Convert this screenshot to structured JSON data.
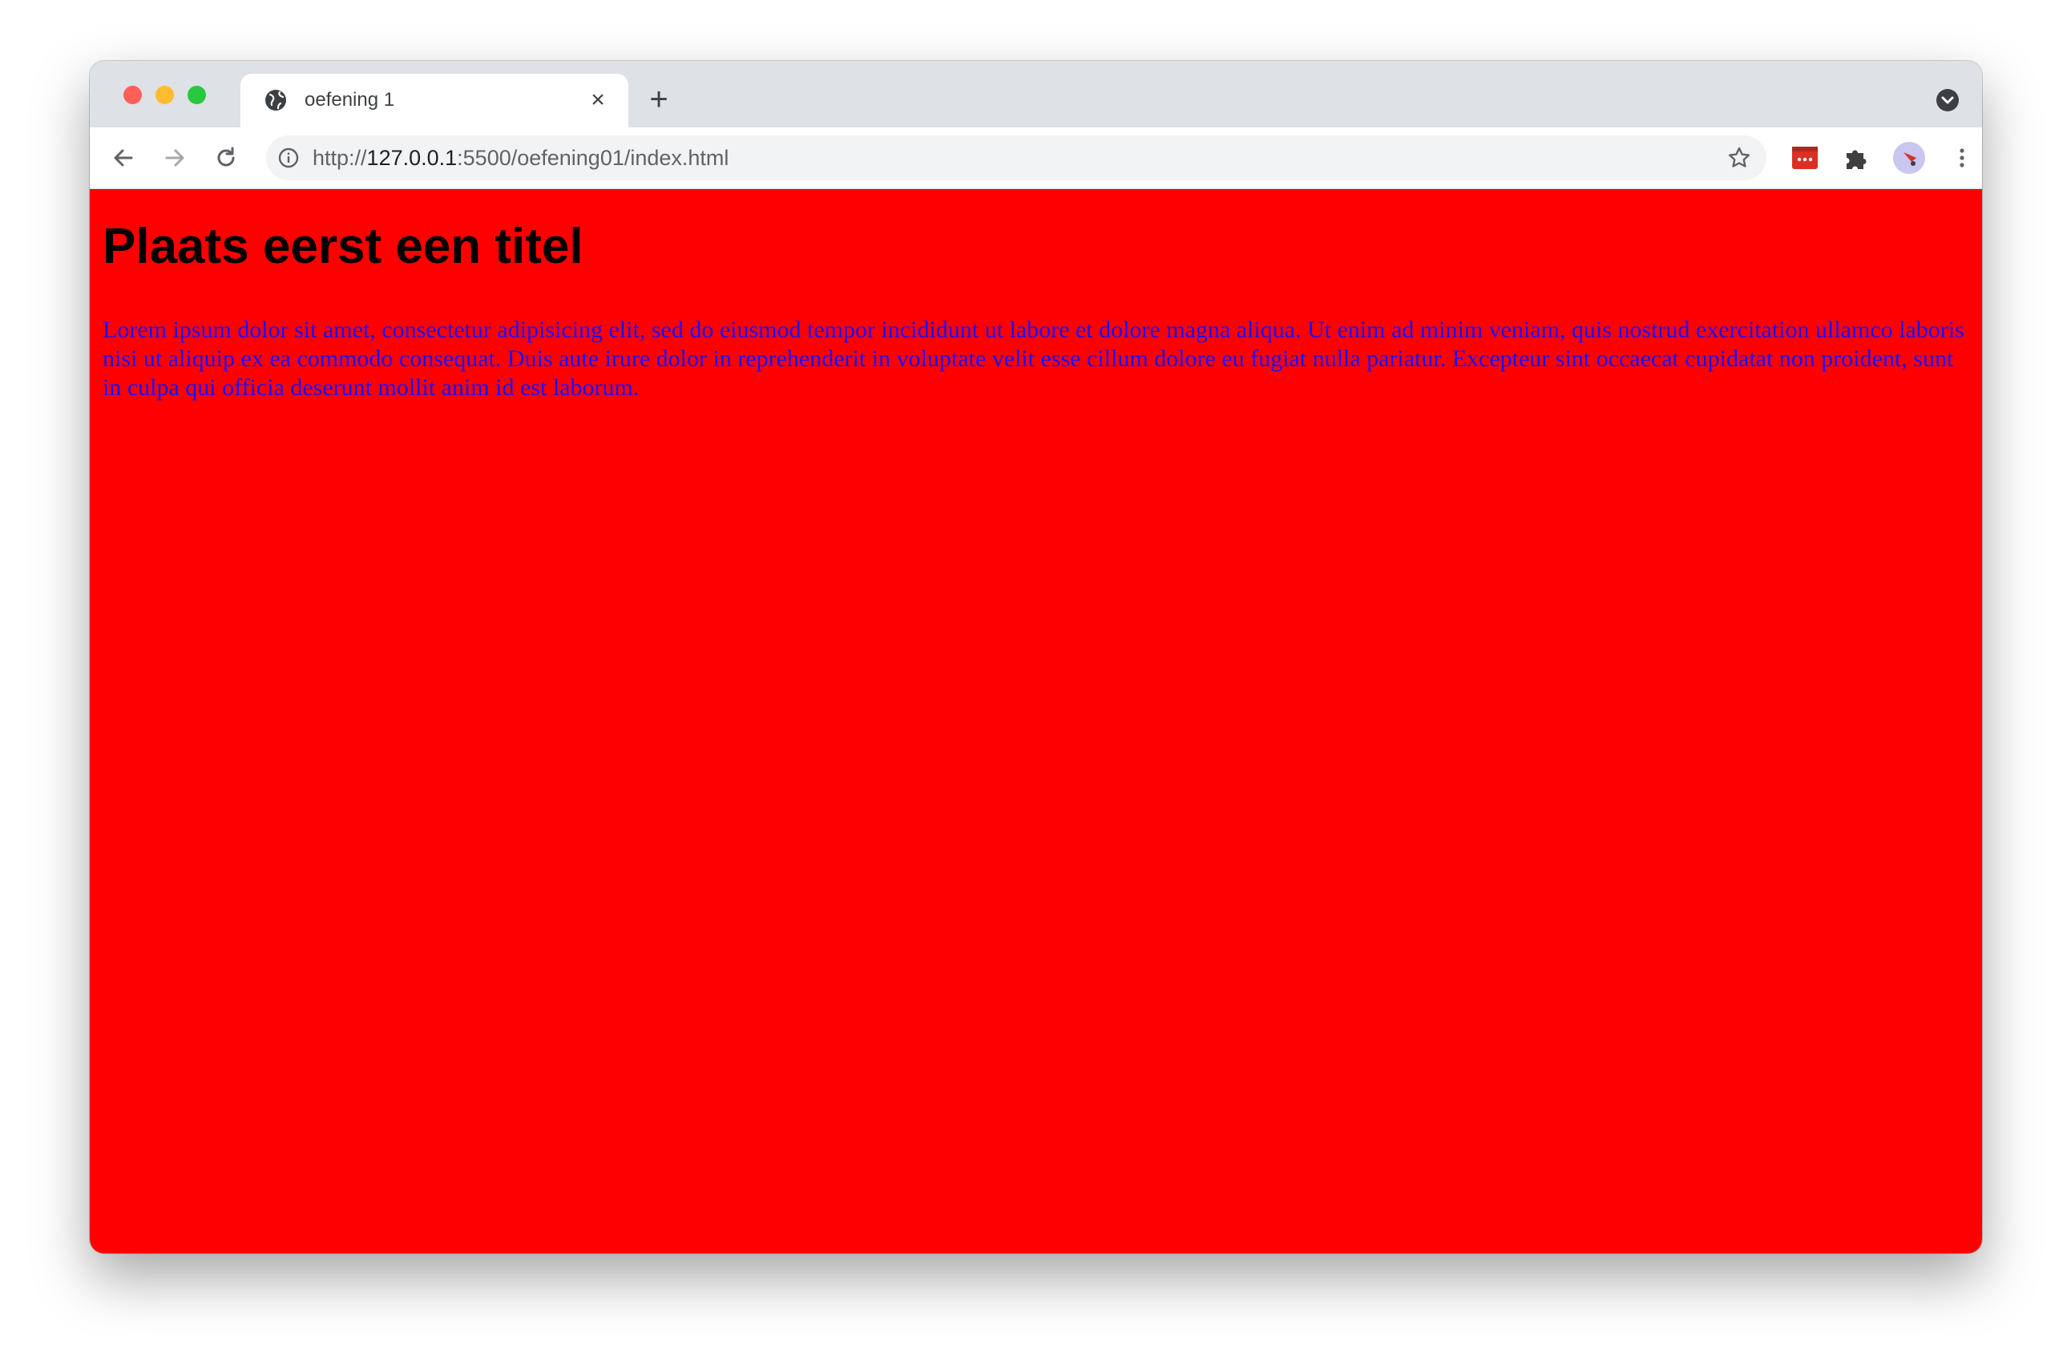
{
  "browser": {
    "tab": {
      "title": "oefening 1",
      "close": "×"
    },
    "new_tab": "+",
    "url": {
      "scheme": "http://",
      "host": "127.0.0.1",
      "rest": ":5500/oefening01/index.html"
    }
  },
  "page": {
    "background_color": "#ff0000",
    "title": "Plaats eerst een titel",
    "title_color": "#000000",
    "paragraph": "Lorem ipsum dolor sit amet, consectetur adipisicing elit, sed do eiusmod tempor incididunt ut labore et dolore magna aliqua. Ut enim ad minim veniam, quis nostrud exercitation ullamco laboris nisi ut aliquip ex ea commodo consequat. Duis aute irure dolor in reprehenderit in voluptate velit esse cillum dolore eu fugiat nulla pariatur. Excepteur sint occaecat cupidatat non proident, sunt in culpa qui officia deserunt mollit anim id est laborum.",
    "paragraph_color": "#1a0dff"
  },
  "icons": {
    "back": "back-arrow-icon",
    "forward": "forward-arrow-icon",
    "reload": "reload-icon",
    "info": "info-icon",
    "bookmark": "star-icon",
    "extension": "red-extension-icon",
    "extensions_menu": "puzzle-icon",
    "profile": "avatar",
    "menu": "kebab-menu-icon"
  }
}
